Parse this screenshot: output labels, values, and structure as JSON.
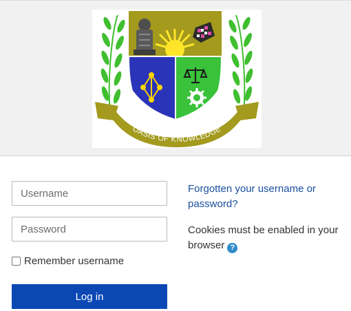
{
  "logo": {
    "motto": "OASIS OF KNOWLEDGE",
    "colors": {
      "gold": "#a39a1e",
      "blue": "#2a34b8",
      "green": "#39c23a",
      "leaf": "#3fbf2f",
      "sun": "#ffe52a"
    }
  },
  "form": {
    "username_placeholder": "Username",
    "password_placeholder": "Password",
    "remember_label": "Remember username",
    "remember_checked": false,
    "login_label": "Log in",
    "login_color": "#0c48b4"
  },
  "help": {
    "forgot_link": "Forgotten your username or password?",
    "cookies_text": "Cookies must be enabled in your browser",
    "help_icon": "question-circle-icon",
    "help_glyph": "?"
  }
}
